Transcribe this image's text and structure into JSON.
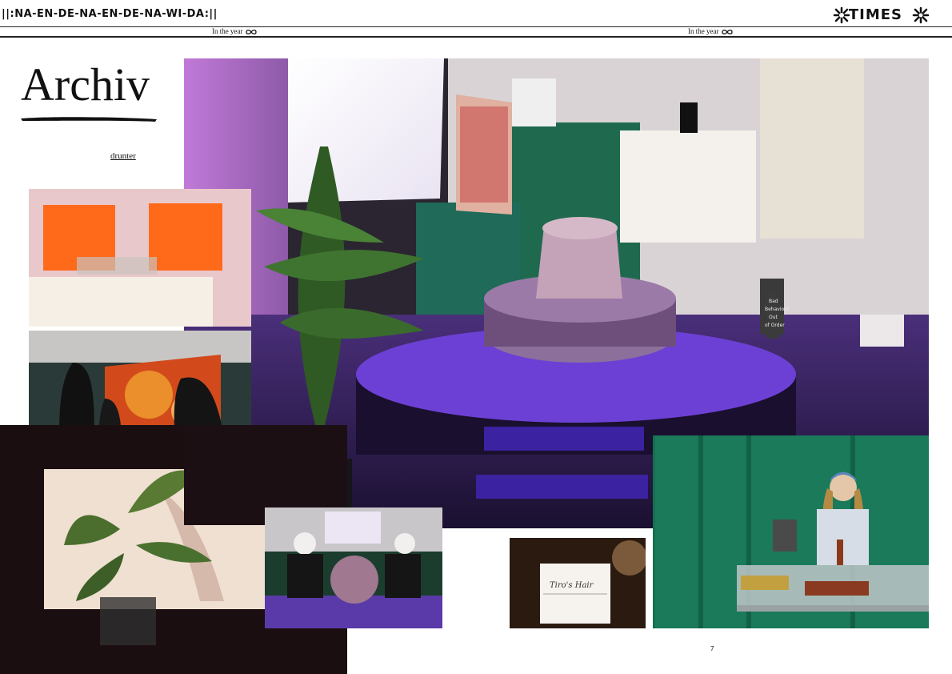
{
  "masthead": {
    "left_title": "||:NA-EN-DE-NA-EN-DE-NA-WI-DA:||",
    "right_title": "TIMES"
  },
  "tagline": {
    "left": "In the year",
    "right": "In the year"
  },
  "page": {
    "heading": "Archiv",
    "link": "drunter",
    "number": "7"
  },
  "photos": {
    "note_card_text": "Tiro's Hair",
    "sign_text_1": "Bad",
    "sign_text_2": "Behaviour",
    "sign_text_3": "Out",
    "sign_text_4": "of Order"
  },
  "icons": [
    "star-left-icon",
    "star-right-icon",
    "infinity-icon",
    "infinity-icon"
  ]
}
